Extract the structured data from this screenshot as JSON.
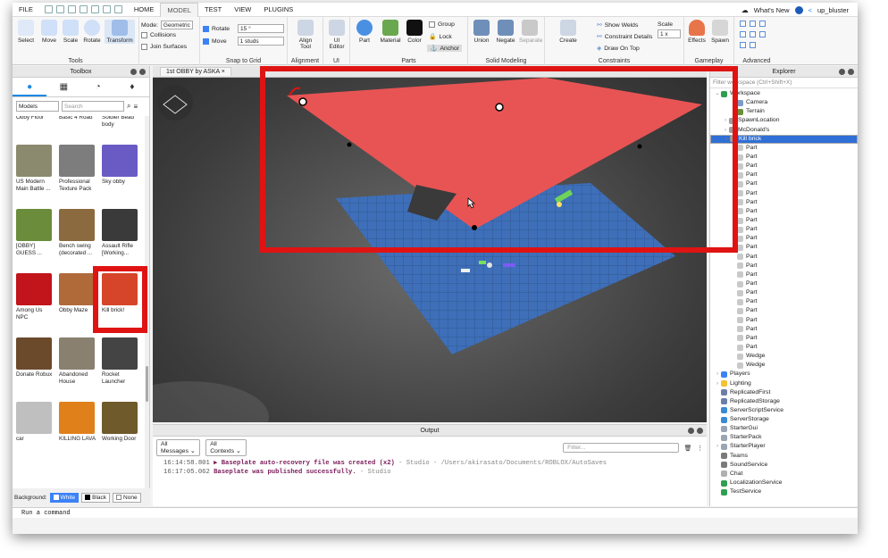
{
  "menu": {
    "items": [
      "FILE",
      "HOME",
      "MODEL",
      "TEST",
      "VIEW",
      "PLUGINS"
    ],
    "active": "MODEL",
    "whats_new": "What's New",
    "user": "up_bluster"
  },
  "ribbon": {
    "tools": {
      "label": "Tools",
      "buttons": [
        "Select",
        "Move",
        "Scale",
        "Rotate",
        "Transform"
      ]
    },
    "mode_label": "Mode:",
    "mode_value": "Geometric",
    "collisions": "Collisions",
    "join_surfaces": "Join Surfaces",
    "snap": {
      "label": "Snap to Grid",
      "rotate_label": "Rotate",
      "rotate_value": "15 °",
      "move_label": "Move",
      "move_value": "1 studs"
    },
    "alignment": {
      "label": "Alignment",
      "button": "Align Tool"
    },
    "ui": {
      "label": "UI",
      "button": "UI Editor"
    },
    "parts": {
      "label": "Parts",
      "buttons": [
        "Part",
        "Material",
        "Color"
      ],
      "group": "Group",
      "lock": "Lock",
      "anchor": "Anchor"
    },
    "solid": {
      "label": "Solid Modeling",
      "buttons": [
        "Union",
        "Negate",
        "Separate"
      ]
    },
    "constraints": {
      "label": "Constraints",
      "create": "Create",
      "show_welds": "Show Welds",
      "constraint_details": "Constraint Details",
      "draw_on_top": "Draw On Top",
      "scale_label": "Scale",
      "scale_value": "1 x"
    },
    "gameplay": {
      "label": "Gameplay",
      "buttons": [
        "Effects",
        "Spawn"
      ]
    },
    "advanced": {
      "label": "Advanced"
    }
  },
  "toolbox": {
    "title": "Toolbox",
    "category": "Models",
    "search_placeholder": "Search",
    "items": [
      {
        "label": "Obby Floor",
        "color": "#b9b9b9"
      },
      {
        "label": "Basic 4 Road",
        "color": "#c7c7c7"
      },
      {
        "label": "Soldier Bead body",
        "color": "#d6d6d6"
      },
      {
        "label": "US Modern Main Battle ...",
        "color": "#8c8a6e"
      },
      {
        "label": "Professional Texture Pack",
        "color": "#7d7d7d"
      },
      {
        "label": "Sky obby",
        "color": "#6a5bc4"
      },
      {
        "label": "[OBBY] GUESS ...",
        "color": "#6b8c3a"
      },
      {
        "label": "Bench swing (decorated ...",
        "color": "#8c6a3f"
      },
      {
        "label": "Assault Rifle [Working...",
        "color": "#3a3a3a"
      },
      {
        "label": "Among Us NPC",
        "color": "#c2141b"
      },
      {
        "label": "Obby Maze",
        "color": "#b06a3a"
      },
      {
        "label": "Kill brick!",
        "color": "#d6452a"
      },
      {
        "label": "Donate Robux",
        "color": "#6b4a2c"
      },
      {
        "label": "Abandoned House",
        "color": "#8a8070"
      },
      {
        "label": "Rocket Launcher",
        "color": "#444444"
      },
      {
        "label": "car",
        "color": "#bfbfbf"
      },
      {
        "label": "KILLING LAVA",
        "color": "#e0801a"
      },
      {
        "label": "Working Door",
        "color": "#6e5a2a"
      }
    ],
    "background_label": "Background:",
    "bg_options": [
      "White",
      "Black",
      "None"
    ]
  },
  "viewport": {
    "tab": "1st OBBY by ASKA"
  },
  "output": {
    "title": "Output",
    "filter_messages": "All Messages",
    "filter_contexts": "All Contexts",
    "filter_placeholder": "Filter...",
    "lines": [
      {
        "time": "16:14:58.801",
        "message": "▶ Baseplate auto-recovery file was created (x2)",
        "source": "- Studio - /Users/akirasato/Documents/ROBLOX/AutoSaves"
      },
      {
        "time": "16:17:05.062",
        "message": "Baseplate was published successfully.",
        "source": "- Studio"
      }
    ]
  },
  "explorer": {
    "title": "Explorer",
    "filter_placeholder": "Filter workspace (Ctrl+Shift+X)",
    "rows": [
      {
        "label": "Workspace",
        "depth": 0,
        "icon": "#2e9e4f",
        "arrow": "v"
      },
      {
        "label": "Camera",
        "depth": 2,
        "icon": "#7a9cc9"
      },
      {
        "label": "Terrain",
        "depth": 2,
        "icon": "#6b8f3a"
      },
      {
        "label": "SpawnLocation",
        "depth": 1,
        "icon": "#9e9e9e",
        "arrow": ">"
      },
      {
        "label": "McDonald's",
        "depth": 1,
        "icon": "#9e9e9e",
        "arrow": ">"
      },
      {
        "label": "Kill brick",
        "depth": 1,
        "icon": "#9e9e9e",
        "arrow": ">",
        "selected": true
      },
      {
        "label": "Part",
        "depth": 2,
        "icon": "#c9c9c9"
      },
      {
        "label": "Part",
        "depth": 2,
        "icon": "#c9c9c9"
      },
      {
        "label": "Part",
        "depth": 2,
        "icon": "#c9c9c9"
      },
      {
        "label": "Part",
        "depth": 2,
        "icon": "#c9c9c9"
      },
      {
        "label": "Part",
        "depth": 2,
        "icon": "#c9c9c9"
      },
      {
        "label": "Part",
        "depth": 2,
        "icon": "#c9c9c9"
      },
      {
        "label": "Part",
        "depth": 2,
        "icon": "#c9c9c9"
      },
      {
        "label": "Part",
        "depth": 2,
        "icon": "#c9c9c9"
      },
      {
        "label": "Part",
        "depth": 2,
        "icon": "#c9c9c9"
      },
      {
        "label": "Part",
        "depth": 2,
        "icon": "#c9c9c9"
      },
      {
        "label": "Part",
        "depth": 2,
        "icon": "#c9c9c9"
      },
      {
        "label": "Part",
        "depth": 2,
        "icon": "#c9c9c9"
      },
      {
        "label": "Part",
        "depth": 2,
        "icon": "#c9c9c9"
      },
      {
        "label": "Part",
        "depth": 2,
        "icon": "#c9c9c9"
      },
      {
        "label": "Part",
        "depth": 2,
        "icon": "#c9c9c9"
      },
      {
        "label": "Part",
        "depth": 2,
        "icon": "#c9c9c9"
      },
      {
        "label": "Part",
        "depth": 2,
        "icon": "#c9c9c9"
      },
      {
        "label": "Part",
        "depth": 2,
        "icon": "#c9c9c9"
      },
      {
        "label": "Part",
        "depth": 2,
        "icon": "#c9c9c9"
      },
      {
        "label": "Part",
        "depth": 2,
        "icon": "#c9c9c9"
      },
      {
        "label": "Part",
        "depth": 2,
        "icon": "#c9c9c9"
      },
      {
        "label": "Part",
        "depth": 2,
        "icon": "#c9c9c9"
      },
      {
        "label": "Part",
        "depth": 2,
        "icon": "#c9c9c9"
      },
      {
        "label": "Wedge",
        "depth": 2,
        "icon": "#c9c9c9"
      },
      {
        "label": "Wedge",
        "depth": 2,
        "icon": "#c9c9c9"
      },
      {
        "label": "Players",
        "depth": 0,
        "icon": "#3b82f6",
        "arrow": ">"
      },
      {
        "label": "Lighting",
        "depth": 0,
        "icon": "#f2c230",
        "arrow": ">"
      },
      {
        "label": "ReplicatedFirst",
        "depth": 0,
        "icon": "#6b7fa8"
      },
      {
        "label": "ReplicatedStorage",
        "depth": 0,
        "icon": "#6b7fa8"
      },
      {
        "label": "ServerScriptService",
        "depth": 0,
        "icon": "#3a8ad6"
      },
      {
        "label": "ServerStorage",
        "depth": 0,
        "icon": "#3a8ad6"
      },
      {
        "label": "StarterGui",
        "depth": 0,
        "icon": "#9aa4b5"
      },
      {
        "label": "StarterPack",
        "depth": 0,
        "icon": "#9aa4b5"
      },
      {
        "label": "StarterPlayer",
        "depth": 0,
        "icon": "#9aa4b5",
        "arrow": ">"
      },
      {
        "label": "Teams",
        "depth": 0,
        "icon": "#7a7a7a"
      },
      {
        "label": "SoundService",
        "depth": 0,
        "icon": "#7a7a7a"
      },
      {
        "label": "Chat",
        "depth": 0,
        "icon": "#b0b0b0"
      },
      {
        "label": "LocalizationService",
        "depth": 0,
        "icon": "#2e9e4f"
      },
      {
        "label": "TestService",
        "depth": 0,
        "icon": "#2e9e4f"
      }
    ]
  },
  "command": {
    "placeholder": "Run a command"
  },
  "colors": {
    "accent": "#2f6fd6",
    "highlight": "#e01313",
    "kill_brick": "#e85454",
    "baseplate": "#3e6fb8"
  }
}
